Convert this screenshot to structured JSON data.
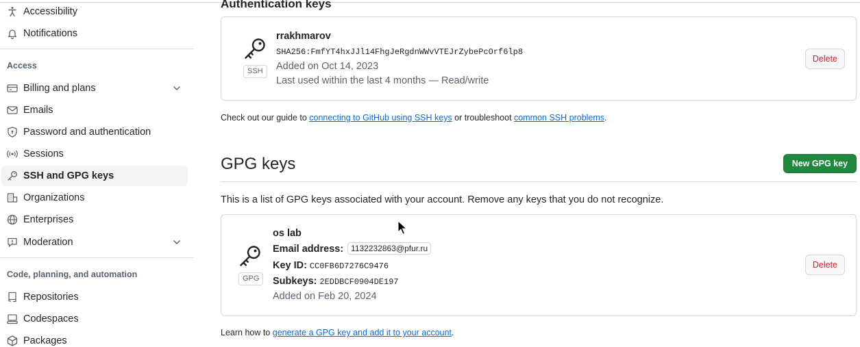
{
  "sidebar": {
    "items_top": [
      {
        "label": "Accessibility",
        "icon": "accessibility-icon"
      },
      {
        "label": "Notifications",
        "icon": "bell-icon"
      }
    ],
    "section_access": "Access",
    "access_items": [
      {
        "label": "Billing and plans",
        "icon": "credit-card-icon"
      },
      {
        "label": "Emails",
        "icon": "mail-icon"
      },
      {
        "label": "Password and authentication",
        "icon": "shield-lock-icon"
      },
      {
        "label": "Sessions",
        "icon": "broadcast-icon"
      },
      {
        "label": "SSH and GPG keys",
        "icon": "key-icon",
        "active": true
      },
      {
        "label": "Organizations",
        "icon": "organization-icon"
      },
      {
        "label": "Enterprises",
        "icon": "globe-icon"
      },
      {
        "label": "Moderation",
        "icon": "report-icon"
      }
    ],
    "section_code": "Code, planning, and automation",
    "code_items": [
      {
        "label": "Repositories",
        "icon": "repo-icon"
      },
      {
        "label": "Codespaces",
        "icon": "codespaces-icon"
      },
      {
        "label": "Packages",
        "icon": "package-icon"
      }
    ]
  },
  "auth_keys": {
    "heading": "Authentication keys",
    "key": {
      "title": "rrakhmarov",
      "badge": "SSH",
      "fingerprint": "SHA256:FmfYT4hxJJl14FhgJeRgdnWWvVTEJrZybePcOrf6lp8",
      "added": "Added on Oct 14, 2023",
      "last_used": "Last used within the last 4 months — Read/write",
      "delete_label": "Delete"
    },
    "guide": {
      "prefix": "Check out our guide to ",
      "link1": "connecting to GitHub using SSH keys",
      "middle": " or troubleshoot ",
      "link2": "common SSH problems",
      "suffix": "."
    }
  },
  "gpg": {
    "heading": "GPG keys",
    "new_button": "New GPG key",
    "description": "This is a list of GPG keys associated with your account. Remove any keys that you do not recognize.",
    "key": {
      "title": "os lab",
      "badge": "GPG",
      "email_label": "Email address:",
      "email": "1132232863@pfur.ru",
      "keyid_label": "Key ID:",
      "keyid": "CC0FB6D7276C9476",
      "subkeys_label": "Subkeys:",
      "subkeys": "2EDDBCF0904DE197",
      "added": "Added on Feb 20, 2024",
      "delete_label": "Delete"
    },
    "learn": {
      "prefix": "Learn how to ",
      "link": "generate a GPG key and add it to your account",
      "suffix": "."
    }
  },
  "colors": {
    "primary": "#1f883d",
    "danger": "#cf222e",
    "link": "#0969da",
    "active_bg": "#f3f4f6"
  }
}
